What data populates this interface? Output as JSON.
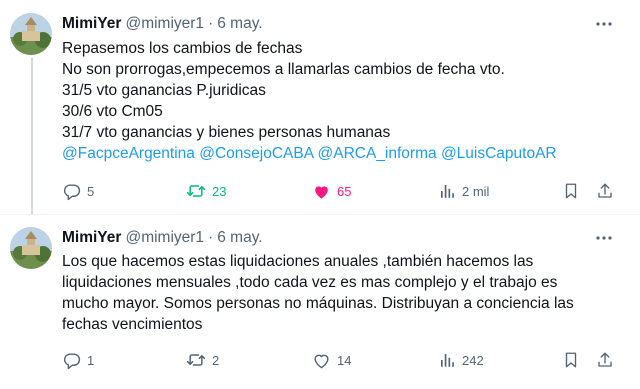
{
  "tweets": [
    {
      "name": "MimiYer",
      "handle": "@mimiyer1",
      "separator": "·",
      "date": "6 may.",
      "lines": [
        "Repasemos los cambios de fechas",
        "No son prorrogas,empecemos a llamarlas cambios de fecha vto.",
        "31/5 vto ganancias P.juridicas",
        "30/6 vto Cm05",
        "31/7 vto ganancias y bienes personas humanas"
      ],
      "mentions": [
        "@FacpceArgentina",
        "@ConsejoCABA",
        "@ARCA_informa",
        "@LuisCaputoAR"
      ],
      "replies": "5",
      "reposts": "23",
      "likes": "65",
      "views": "2 mil",
      "repost_color": "#00ba7c",
      "like_color": "#f91880",
      "liked": true,
      "reposted": true
    },
    {
      "name": "MimiYer",
      "handle": "@mimiyer1",
      "separator": "·",
      "date": "6 may.",
      "lines": [
        "Los que hacemos estas liquidaciones anuales ,también hacemos las",
        "liquidaciones mensuales ,todo cada vez es mas complejo y el trabajo es",
        "mucho mayor. Somos personas no máquinas. Distribuyan a conciencia las",
        "fechas vencimientos"
      ],
      "replies": "1",
      "reposts": "2",
      "likes": "14",
      "views": "242",
      "liked": false,
      "reposted": false
    }
  ],
  "icons": {
    "reply": "reply-icon",
    "repost": "repost-icon",
    "like": "heart-icon",
    "views": "views-icon",
    "bookmark": "bookmark-icon",
    "share": "share-icon",
    "more": "more-icon"
  },
  "colors": {
    "mention": "#1d9bf0",
    "secondary_text": "#536471"
  }
}
